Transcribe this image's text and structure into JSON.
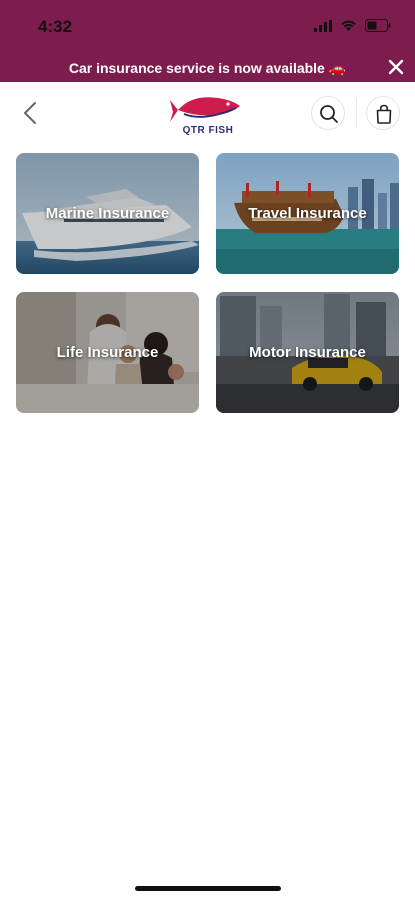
{
  "status_bar": {
    "time": "4:32"
  },
  "banner": {
    "text": "Car insurance service is now available 🚗"
  },
  "header": {
    "logo_text": "QTR FISH"
  },
  "cards": [
    {
      "label": "Marine Insurance"
    },
    {
      "label": "Travel Insurance"
    },
    {
      "label": "Life Insurance"
    },
    {
      "label": "Motor Insurance"
    }
  ],
  "colors": {
    "brand": "#7d1d4e",
    "accent": "#d01c4c",
    "logo_blue": "#2b2d7a"
  }
}
